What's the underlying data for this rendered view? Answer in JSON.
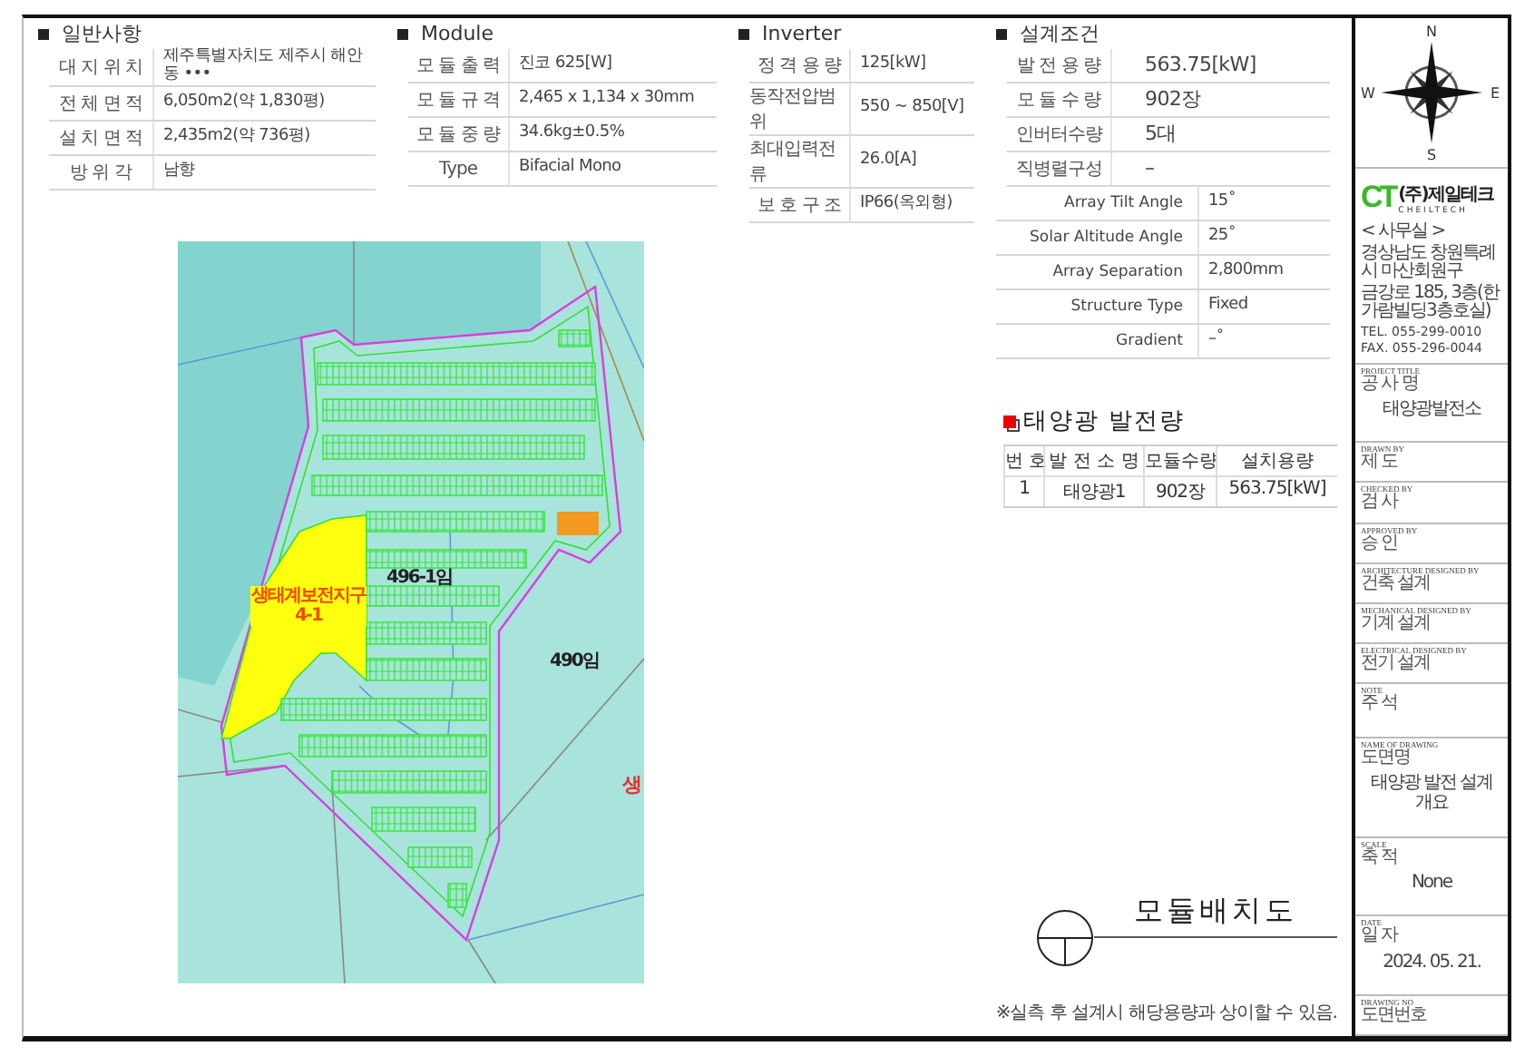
{
  "general": {
    "title": "일반사항",
    "rows": [
      {
        "label": "대 지 위 치",
        "value": "제주특별자치도 제주시 해안동 •••"
      },
      {
        "label": "전 체 면 적",
        "value": "6,050m2(약 1,830평)"
      },
      {
        "label": "설 치 면 적",
        "value": "2,435m2(약 736평)"
      },
      {
        "label": "방 위 각",
        "value": "남향"
      }
    ]
  },
  "module": {
    "title": "Module",
    "rows": [
      {
        "label": "모 듈 출 력",
        "value": "진코 625[W]"
      },
      {
        "label": "모 듈 규 격",
        "value": "2,465 x 1,134 x 30mm"
      },
      {
        "label": "모 듈 중 량",
        "value": "34.6kg±0.5%"
      },
      {
        "label": "Type",
        "value": "Bifacial Mono"
      }
    ]
  },
  "inverter": {
    "title": "Inverter",
    "rows": [
      {
        "label": "정 격 용 량",
        "value": "125[kW]"
      },
      {
        "label": "동작전압범위",
        "value": "550 ~ 850[V]"
      },
      {
        "label": "최대입력전류",
        "value": "26.0[A]"
      },
      {
        "label": "보 호 구 조",
        "value": "IP66(옥외형)"
      }
    ]
  },
  "design": {
    "title": "설계조건",
    "rows": [
      {
        "label": "발 전 용 량",
        "value": "563.75[kW]"
      },
      {
        "label": "모 듈 수 량",
        "value": "902장"
      },
      {
        "label": "인버터수량",
        "value": "5대"
      },
      {
        "label": "직병렬구성",
        "value": "–"
      }
    ],
    "angle_rows": [
      {
        "label": "Array Tilt Angle",
        "value": "15˚"
      },
      {
        "label": "Solar Altitude Angle",
        "value": "25˚"
      },
      {
        "label": "Array Separation",
        "value": "2,800mm"
      },
      {
        "label": "Structure Type",
        "value": "Fixed"
      },
      {
        "label": "Gradient",
        "value": "–˚"
      }
    ]
  },
  "map": {
    "parcel_main": "496-1임",
    "parcel_east": "490임",
    "zone": "생태계보전지구 4-1",
    "edge_text": "생"
  },
  "power": {
    "title": "태양광 발전량",
    "columns": [
      "번 호",
      "발 전 소 명",
      "모듈수량",
      "설치용량"
    ],
    "rows": [
      [
        "1",
        "태양광1",
        "902장",
        "563.75[kW]"
      ]
    ]
  },
  "drawing_title": "모듈배치도",
  "note": "※실측 후 설계시 해당용량과 상이할 수 있음.",
  "title_block": {
    "compass": {
      "n": "N",
      "e": "E",
      "s": "S",
      "w": "W"
    },
    "company": {
      "mark": "CT",
      "name": "(주)제일테크",
      "latin": "CHEILTECH",
      "office": "< 사무실 >",
      "address": [
        "경상남도 창원특례시 마산회원구",
        "금강로 185, 3층(한가람빌딩3층호실)"
      ],
      "tel": "TEL. 055-299-0010",
      "fax": "FAX. 055-296-0044"
    },
    "fields": [
      {
        "en": "PROJECT TITLE",
        "ko": "공 사 명",
        "value": "태양광발전소"
      },
      {
        "en": "DRAWN BY",
        "ko": "제 도"
      },
      {
        "en": "CHECKED BY",
        "ko": "검 사"
      },
      {
        "en": "APPROVED BY",
        "ko": "승 인"
      },
      {
        "en": "ARCHITECTURE DESIGNED BY",
        "ko": "건축 설계"
      },
      {
        "en": "MECHANICAL DESIGNED BY",
        "ko": "기계 설계"
      },
      {
        "en": "ELECTRICAL DESIGNED BY",
        "ko": "전기 설계"
      },
      {
        "en": "NOTE",
        "ko": "주 석"
      },
      {
        "en": "NAME OF DRAWING",
        "ko": "도면명",
        "value": "태양광 발전 설계 개요"
      },
      {
        "en": "SCALE",
        "ko": "축 적",
        "value": "None"
      },
      {
        "en": "DATE",
        "ko": "일 자",
        "value": "2024. 05. 21."
      },
      {
        "en": "DRAWING NO",
        "ko": "도면번호"
      }
    ]
  }
}
